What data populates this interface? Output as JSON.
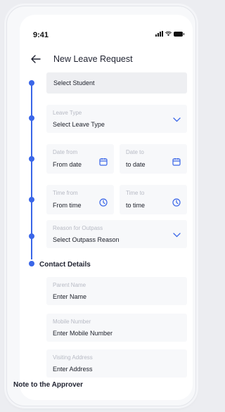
{
  "status_bar": {
    "time": "9:41"
  },
  "header": {
    "title": "New Leave Request"
  },
  "form": {
    "student": {
      "value": "Select Student"
    },
    "leave_type": {
      "label": "Leave Type",
      "value": "Select Leave Type",
      "icon": "chevron-down-icon"
    },
    "date_from": {
      "label": "Date from",
      "value": "From date",
      "icon": "calendar-icon"
    },
    "date_to": {
      "label": "Date to",
      "value": "to date",
      "icon": "calendar-icon"
    },
    "time_from": {
      "label": "Time from",
      "value": "From time",
      "icon": "clock-icon"
    },
    "time_to": {
      "label": "Time to",
      "value": "to time",
      "icon": "clock-icon"
    },
    "reason": {
      "label": "Reason for Outpass",
      "value": "Select Outpass Reason",
      "icon": "chevron-down-icon"
    }
  },
  "contact": {
    "title": "Contact Details",
    "parent_name": {
      "label": "Parent Name",
      "value": "Enter Name"
    },
    "mobile": {
      "label": "Mobile Number",
      "value": "Enter Mobile Number"
    },
    "address": {
      "label": "Visiting Address",
      "value": "Enter Address"
    }
  },
  "note": {
    "title": "Note to the Approver"
  },
  "colors": {
    "accent": "#3a66e8",
    "field_bg": "#f7f8fa",
    "label": "#b7bac4"
  }
}
